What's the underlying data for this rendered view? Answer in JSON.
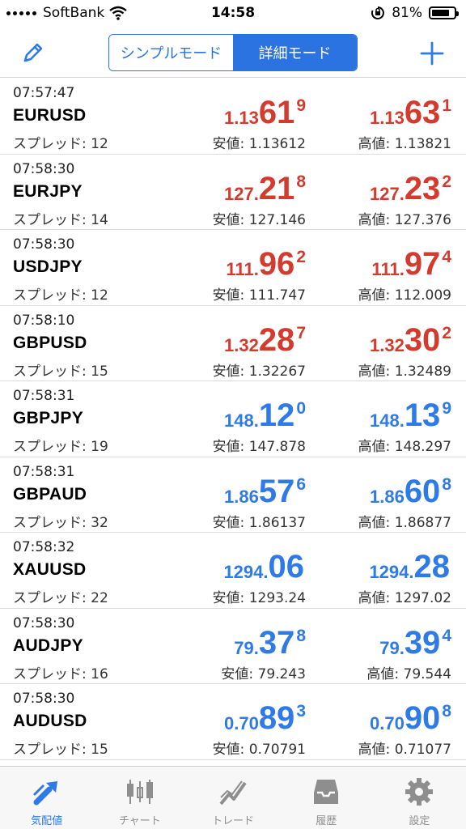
{
  "status_bar": {
    "carrier": "SoftBank",
    "time": "14:58",
    "battery": "81%",
    "battery_level": 0.81
  },
  "nav": {
    "segments": [
      {
        "label": "シンプルモード",
        "active": false
      },
      {
        "label": "詳細モード",
        "active": true
      }
    ]
  },
  "colors": {
    "accent": "#2e7ae6",
    "up_red": "#d43b2f"
  },
  "quotes": [
    {
      "time": "07:57:47",
      "symbol": "EURUSD",
      "spread": "スプレッド: 12",
      "color": "red",
      "bid": {
        "small": "1.13",
        "big": "61",
        "sup": "9"
      },
      "ask": {
        "small": "1.13",
        "big": "63",
        "sup": "1"
      },
      "low": "安値: 1.13612",
      "high": "高値: 1.13821"
    },
    {
      "time": "07:58:30",
      "symbol": "EURJPY",
      "spread": "スプレッド: 14",
      "color": "red",
      "bid": {
        "small": "127.",
        "big": "21",
        "sup": "8"
      },
      "ask": {
        "small": "127.",
        "big": "23",
        "sup": "2"
      },
      "low": "安値: 127.146",
      "high": "高値: 127.376"
    },
    {
      "time": "07:58:30",
      "symbol": "USDJPY",
      "spread": "スプレッド: 12",
      "color": "red",
      "bid": {
        "small": "111.",
        "big": "96",
        "sup": "2"
      },
      "ask": {
        "small": "111.",
        "big": "97",
        "sup": "4"
      },
      "low": "安値: 111.747",
      "high": "高値: 112.009"
    },
    {
      "time": "07:58:10",
      "symbol": "GBPUSD",
      "spread": "スプレッド: 15",
      "color": "red",
      "bid": {
        "small": "1.32",
        "big": "28",
        "sup": "7"
      },
      "ask": {
        "small": "1.32",
        "big": "30",
        "sup": "2"
      },
      "low": "安値: 1.32267",
      "high": "高値: 1.32489"
    },
    {
      "time": "07:58:31",
      "symbol": "GBPJPY",
      "spread": "スプレッド: 19",
      "color": "blue",
      "bid": {
        "small": "148.",
        "big": "12",
        "sup": "0"
      },
      "ask": {
        "small": "148.",
        "big": "13",
        "sup": "9"
      },
      "low": "安値: 147.878",
      "high": "高値: 148.297"
    },
    {
      "time": "07:58:31",
      "symbol": "GBPAUD",
      "spread": "スプレッド: 32",
      "color": "blue",
      "bid": {
        "small": "1.86",
        "big": "57",
        "sup": "6"
      },
      "ask": {
        "small": "1.86",
        "big": "60",
        "sup": "8"
      },
      "low": "安値: 1.86137",
      "high": "高値: 1.86877"
    },
    {
      "time": "07:58:32",
      "symbol": "XAUUSD",
      "spread": "スプレッド: 22",
      "color": "blue",
      "bid": {
        "small": "1294.",
        "big": "06",
        "sup": ""
      },
      "ask": {
        "small": "1294.",
        "big": "28",
        "sup": ""
      },
      "low": "安値: 1293.24",
      "high": "高値: 1297.02"
    },
    {
      "time": "07:58:30",
      "symbol": "AUDJPY",
      "spread": "スプレッド: 16",
      "color": "blue",
      "bid": {
        "small": "79.",
        "big": "37",
        "sup": "8"
      },
      "ask": {
        "small": "79.",
        "big": "39",
        "sup": "4"
      },
      "low": "安値: 79.243",
      "high": "高値: 79.544"
    },
    {
      "time": "07:58:30",
      "symbol": "AUDUSD",
      "spread": "スプレッド: 15",
      "color": "blue",
      "bid": {
        "small": "0.70",
        "big": "89",
        "sup": "3"
      },
      "ask": {
        "small": "0.70",
        "big": "90",
        "sup": "8"
      },
      "low": "安値: 0.70791",
      "high": "高値: 0.71077"
    }
  ],
  "tabs": [
    {
      "label": "気配値",
      "icon": "quotes-arrow-icon",
      "selected": true
    },
    {
      "label": "チャート",
      "icon": "candlestick-chart-icon",
      "selected": false
    },
    {
      "label": "トレード",
      "icon": "trade-line-icon",
      "selected": false
    },
    {
      "label": "履歴",
      "icon": "inbox-history-icon",
      "selected": false
    },
    {
      "label": "設定",
      "icon": "gear-icon",
      "selected": false
    }
  ]
}
